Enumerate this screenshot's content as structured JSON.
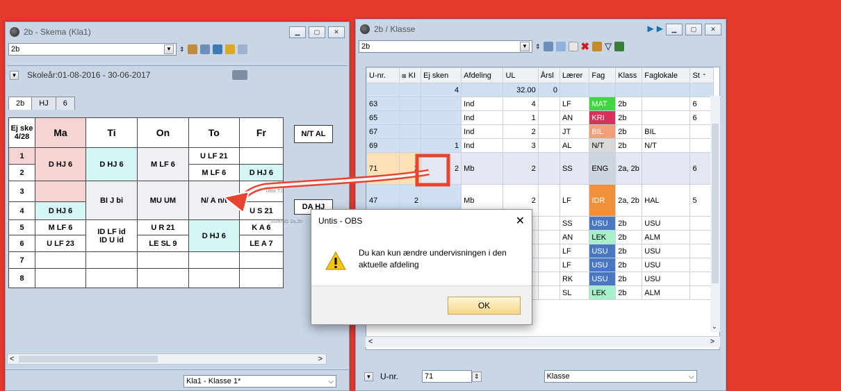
{
  "left_window": {
    "title": "2b -  Skema (Kla1)",
    "combo_value": "2b",
    "school_year": "Skoleår:01-08-2016 - 30-06-2017",
    "tabs": [
      "2b",
      "HJ",
      "6"
    ],
    "corner_label": "Ej ske\n4/28",
    "days": [
      "Ma",
      "Ti",
      "On",
      "To",
      "Fr"
    ],
    "periods": [
      "1",
      "2",
      "3",
      "4",
      "5",
      "6",
      "7",
      "8"
    ],
    "side_box": "N/T AL",
    "side_box2": "DA HJ",
    "status_combo": "Kla1 - Klasse 1*",
    "cells": {
      "ma_12": "D HJ 6",
      "ti_12": "D HJ 6",
      "on_12": "M LF 6",
      "to_1": "U LF 21",
      "to_2": "M LF 6",
      "fr_2": "D HJ 6",
      "ti_34": "BI J bi",
      "on_34": "MU UM",
      "to_34": "N/ A n/t",
      "fr_4": "U S 21",
      "ma_4": "D HJ 6",
      "ma_5": "M LF 6",
      "ma_6": "U LF 23",
      "ti_56a": "ID LF id",
      "ti_56b": "ID U  id",
      "on_5": "U R 21",
      "on_6": "LE SL 9",
      "to_56": "D HJ 6",
      "fr_5": "K A 6",
      "fr_6": "LE A 7",
      "overlay1": "Utov  T1",
      "overlay2": "SS/ENG  2a,2b"
    }
  },
  "right_window": {
    "title": "2b / Klasse",
    "combo_value": "2b",
    "headers": [
      "U-nr.",
      "KI",
      "Ej sken",
      "Afdeling",
      "UL",
      "Årsl",
      "Lærer",
      "Fag",
      "Klass",
      "Faglokale",
      "St"
    ],
    "sum_row": {
      "ej": "4",
      "ul": "32.00",
      "arsl": "0"
    },
    "rows": [
      {
        "unr": "63",
        "ki": "",
        "ej": "",
        "afd": "Ind",
        "ul": "4",
        "arsl": "",
        "laerer": "LF",
        "fag": "MAT",
        "fagcolor": "#3fd63f",
        "klass": "2b",
        "lok": "",
        "st": "6"
      },
      {
        "unr": "65",
        "ki": "",
        "ej": "",
        "afd": "Ind",
        "ul": "1",
        "arsl": "",
        "laerer": "AN",
        "fag": "KRI",
        "fagcolor": "#d8315b",
        "klass": "2b",
        "lok": "",
        "st": "6"
      },
      {
        "unr": "67",
        "ki": "",
        "ej": "",
        "afd": "Ind",
        "ul": "2",
        "arsl": "",
        "laerer": "JT",
        "fag": "BIL",
        "fagcolor": "#f2a07a",
        "klass": "2b",
        "lok": "BIL",
        "st": ""
      },
      {
        "unr": "69",
        "ki": "",
        "ej": "1",
        "afd": "Ind",
        "ul": "3",
        "arsl": "",
        "laerer": "AL",
        "fag": "N/T",
        "fagcolor": "#d9d9d9",
        "klass": "2b",
        "lok": "N/T",
        "st": ""
      },
      {
        "unr": "71",
        "ki": "2",
        "ej": "2",
        "afd": "Mb",
        "ul": "2",
        "arsl": "",
        "laerer": "SS",
        "fag": "ENG",
        "fagcolor": "#cfd5de",
        "klass": "2a, 2b",
        "lok": "",
        "st": "6"
      },
      {
        "unr": "47",
        "ki": "2",
        "ej": "",
        "afd": "Mb",
        "ul": "2",
        "arsl": "",
        "laerer": "LF",
        "fag": "IDR",
        "fagcolor": "#f0903a",
        "klass": "2a, 2b",
        "lok": "HAL",
        "st": "5"
      },
      {
        "unr": "",
        "ki": "",
        "ej": "",
        "afd": "",
        "ul": "",
        "arsl": "",
        "laerer": "SS",
        "fag": "USU",
        "fagcolor": "#4a77c2",
        "klass": "2b",
        "lok": "USU",
        "st": ""
      },
      {
        "unr": "",
        "ki": "",
        "ej": "",
        "afd": "",
        "ul": "",
        "arsl": "",
        "laerer": "AN",
        "fag": "LEK",
        "fagcolor": "#a8efcc",
        "klass": "2b",
        "lok": "ALM",
        "st": ""
      },
      {
        "unr": "",
        "ki": "",
        "ej": "",
        "afd": "",
        "ul": "",
        "arsl": "",
        "laerer": "LF",
        "fag": "USU",
        "fagcolor": "#4a77c2",
        "klass": "2b",
        "lok": "USU",
        "st": ""
      },
      {
        "unr": "",
        "ki": "",
        "ej": "",
        "afd": "",
        "ul": "",
        "arsl": "",
        "laerer": "LF",
        "fag": "USU",
        "fagcolor": "#4a77c2",
        "klass": "2b",
        "lok": "USU",
        "st": ""
      },
      {
        "unr": "",
        "ki": "",
        "ej": "",
        "afd": "",
        "ul": "",
        "arsl": "",
        "laerer": "RK",
        "fag": "USU",
        "fagcolor": "#4a77c2",
        "klass": "2b",
        "lok": "USU",
        "st": ""
      },
      {
        "unr": "",
        "ki": "",
        "ej": "",
        "afd": "",
        "ul": "",
        "arsl": "",
        "laerer": "SL",
        "fag": "LEK",
        "fagcolor": "#a8efcc",
        "klass": "2b",
        "lok": "ALM",
        "st": ""
      }
    ],
    "footer_label": "U-nr.",
    "footer_value": "71",
    "footer_combo": "Klasse"
  },
  "dialog": {
    "title": "Untis - OBS",
    "message": "Du kan kun ændre undervisningen i den aktuelle afdeling",
    "ok": "OK"
  }
}
